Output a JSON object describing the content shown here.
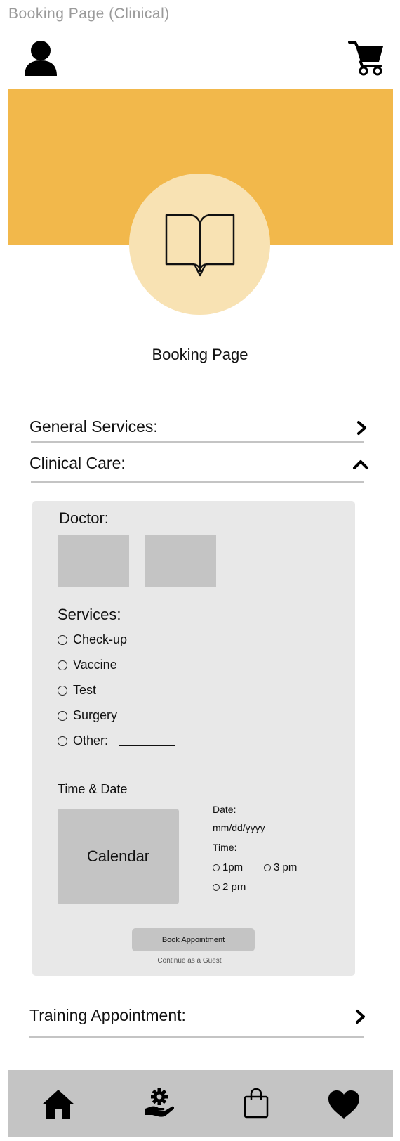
{
  "caption": "Booking Page (Clinical)",
  "icons": {
    "profile": "user-icon",
    "cart": "shopping-cart-icon",
    "hero": "open-book-icon",
    "home": "home-icon",
    "services": "hand-gear-icon",
    "shop": "shopping-bag-icon",
    "favorites": "heart-icon"
  },
  "colors": {
    "hero_band": "#f2b84b",
    "hero_circle": "#f8e2b3",
    "panel": "#e8e8e8",
    "placeholder": "#c4c4c4"
  },
  "page_title": "Booking Page",
  "sections": {
    "general": {
      "label": "General Services:",
      "state": "collapsed"
    },
    "clinical": {
      "label": "Clinical Care:",
      "state": "expanded"
    },
    "training": {
      "label": "Training Appointment:",
      "state": "collapsed"
    }
  },
  "clinical": {
    "doctor_label": "Doctor:",
    "services_label": "Services:",
    "services": [
      "Check-up",
      "Vaccine",
      "Test",
      "Surgery",
      "Other:"
    ],
    "time_date_label": "Time & Date",
    "calendar_label": "Calendar",
    "date_label": "Date:",
    "date_placeholder": "mm/dd/yyyy",
    "time_label": "Time:",
    "time_options": [
      "1pm",
      "3 pm",
      "2 pm"
    ],
    "book_button": "Book Appointment",
    "guest_link": "Continue as a Guest"
  }
}
